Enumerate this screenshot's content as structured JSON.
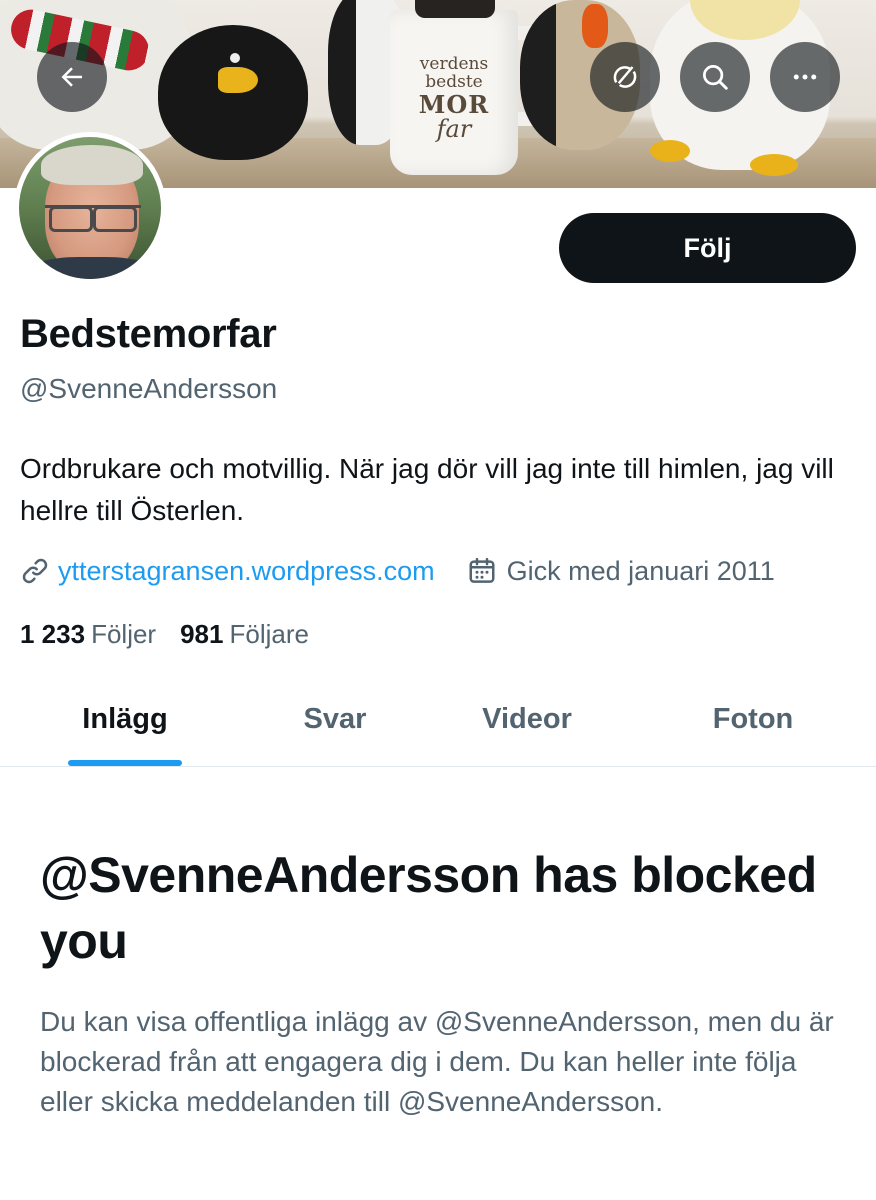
{
  "header": {
    "back_icon": "back-arrow-icon",
    "grok_icon": "grok-icon",
    "search_icon": "search-icon",
    "more_icon": "more-icon"
  },
  "banner": {
    "mug_text": [
      "verdens",
      "bedste",
      "MOR",
      "far"
    ]
  },
  "profile": {
    "follow_label": "Följ",
    "display_name": "Bedstemorfar",
    "handle": "@SvenneAndersson",
    "bio": "Ordbrukare och motvillig. När jag dör vill jag inte till himlen, jag vill hellre till Österlen.",
    "website": "ytterstagransen.wordpress.com",
    "joined": "Gick med januari 2011",
    "following_count": "1 233",
    "following_label": "Följer",
    "followers_count": "981",
    "followers_label": "Följare"
  },
  "tabs": [
    {
      "label": "Inlägg",
      "active": true
    },
    {
      "label": "Svar",
      "active": false
    },
    {
      "label": "Videor",
      "active": false
    },
    {
      "label": "Foton",
      "active": false
    }
  ],
  "blocked": {
    "title": "@SvenneAndersson has blocked you",
    "description": "Du kan visa offentliga inlägg av @SvenneAndersson, men du är blockerad från att engagera dig i dem. Du kan heller inte följa eller skicka meddelanden till @SvenneAndersson."
  },
  "colors": {
    "accent": "#1d9bf0",
    "text_primary": "#0f1419",
    "text_secondary": "#536471",
    "button_dark": "#0f1419"
  }
}
